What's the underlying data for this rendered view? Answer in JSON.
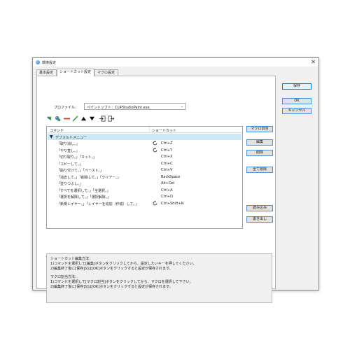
{
  "window": {
    "title": "環境設定",
    "close": "✕"
  },
  "tabs": [
    {
      "label": "基本設定",
      "active": false
    },
    {
      "label": "ショートカット設定",
      "active": true
    },
    {
      "label": "マクロ設定",
      "active": false
    }
  ],
  "profile": {
    "label": "プロファイル：",
    "value": "ペイントソフト：CLIPStudioPaint.exe"
  },
  "toolbar": {
    "icons": [
      "brush-arrow-icon",
      "palette-icon",
      "line-red-icon",
      "line-green-icon",
      "triangle-up-icon",
      "triangle-down-icon",
      "import-icon",
      "export-icon"
    ]
  },
  "list": {
    "header": {
      "command": "コマンド",
      "shortcut": "ショートカット"
    },
    "group": "デフォルトメニュー",
    "rows": [
      {
        "command": "「取り消し。」",
        "shortcut": "Ctrl+Z",
        "macro": true
      },
      {
        "command": "「やり直し。」",
        "shortcut": "Ctrl+Y",
        "macro": true
      },
      {
        "command": "「切り取り。」「カット。」",
        "shortcut": "Ctrl+X",
        "macro": false
      },
      {
        "command": "「コピーして。」",
        "shortcut": "Ctrl+C",
        "macro": false
      },
      {
        "command": "「貼り付けて。」「ペースト。」",
        "shortcut": "Ctrl+V",
        "macro": false
      },
      {
        "command": "「消去して。」「削除して。」「クリアー。」",
        "shortcut": "BackSpace",
        "macro": false
      },
      {
        "command": "「塗りつぶし。」",
        "shortcut": "Alt+Del",
        "macro": false
      },
      {
        "command": "「すべてを選択して。」「全選択。」",
        "shortcut": "Ctrl+A",
        "macro": false
      },
      {
        "command": "「選択を解除して。」「選択解除。」",
        "shortcut": "Ctrl+D",
        "macro": false
      },
      {
        "command": "「新規レイヤー。」「レイヤーを追加（作成）して。」",
        "shortcut": "Ctrl+Shift+N",
        "macro": true
      }
    ]
  },
  "side_buttons": {
    "macro_assign": "マクロ割当",
    "edit": "編集",
    "delete": "削除",
    "delete_all": "全て削除",
    "load": "読み込み",
    "save_as": "書き出し"
  },
  "right_buttons": {
    "save": "保存",
    "ok": "OK",
    "cancel": "キャンセル"
  },
  "help": {
    "shortcut_title": "ショートカット編集方法：",
    "shortcut_1": "1)コマンドを選択して[編集]ボタンをクリックしてから、設定したいキーを押してください。",
    "shortcut_2": "2)編集終了後に[保存]又は[OK]ボタンをクリックすると設定が保存されます。",
    "macro_title": "マクロ割当方法：",
    "macro_1": "1)コマンドを選択して[マクロ割当]ボタンをクリックしてから、マクロを選択して下さい。",
    "macro_2": "2)編集終了後に[保存]又は[OK]ボタンをクリックすると設定が保存されます。"
  },
  "colors": {
    "selection": "#cce8f4",
    "accent": "#0078d7"
  }
}
